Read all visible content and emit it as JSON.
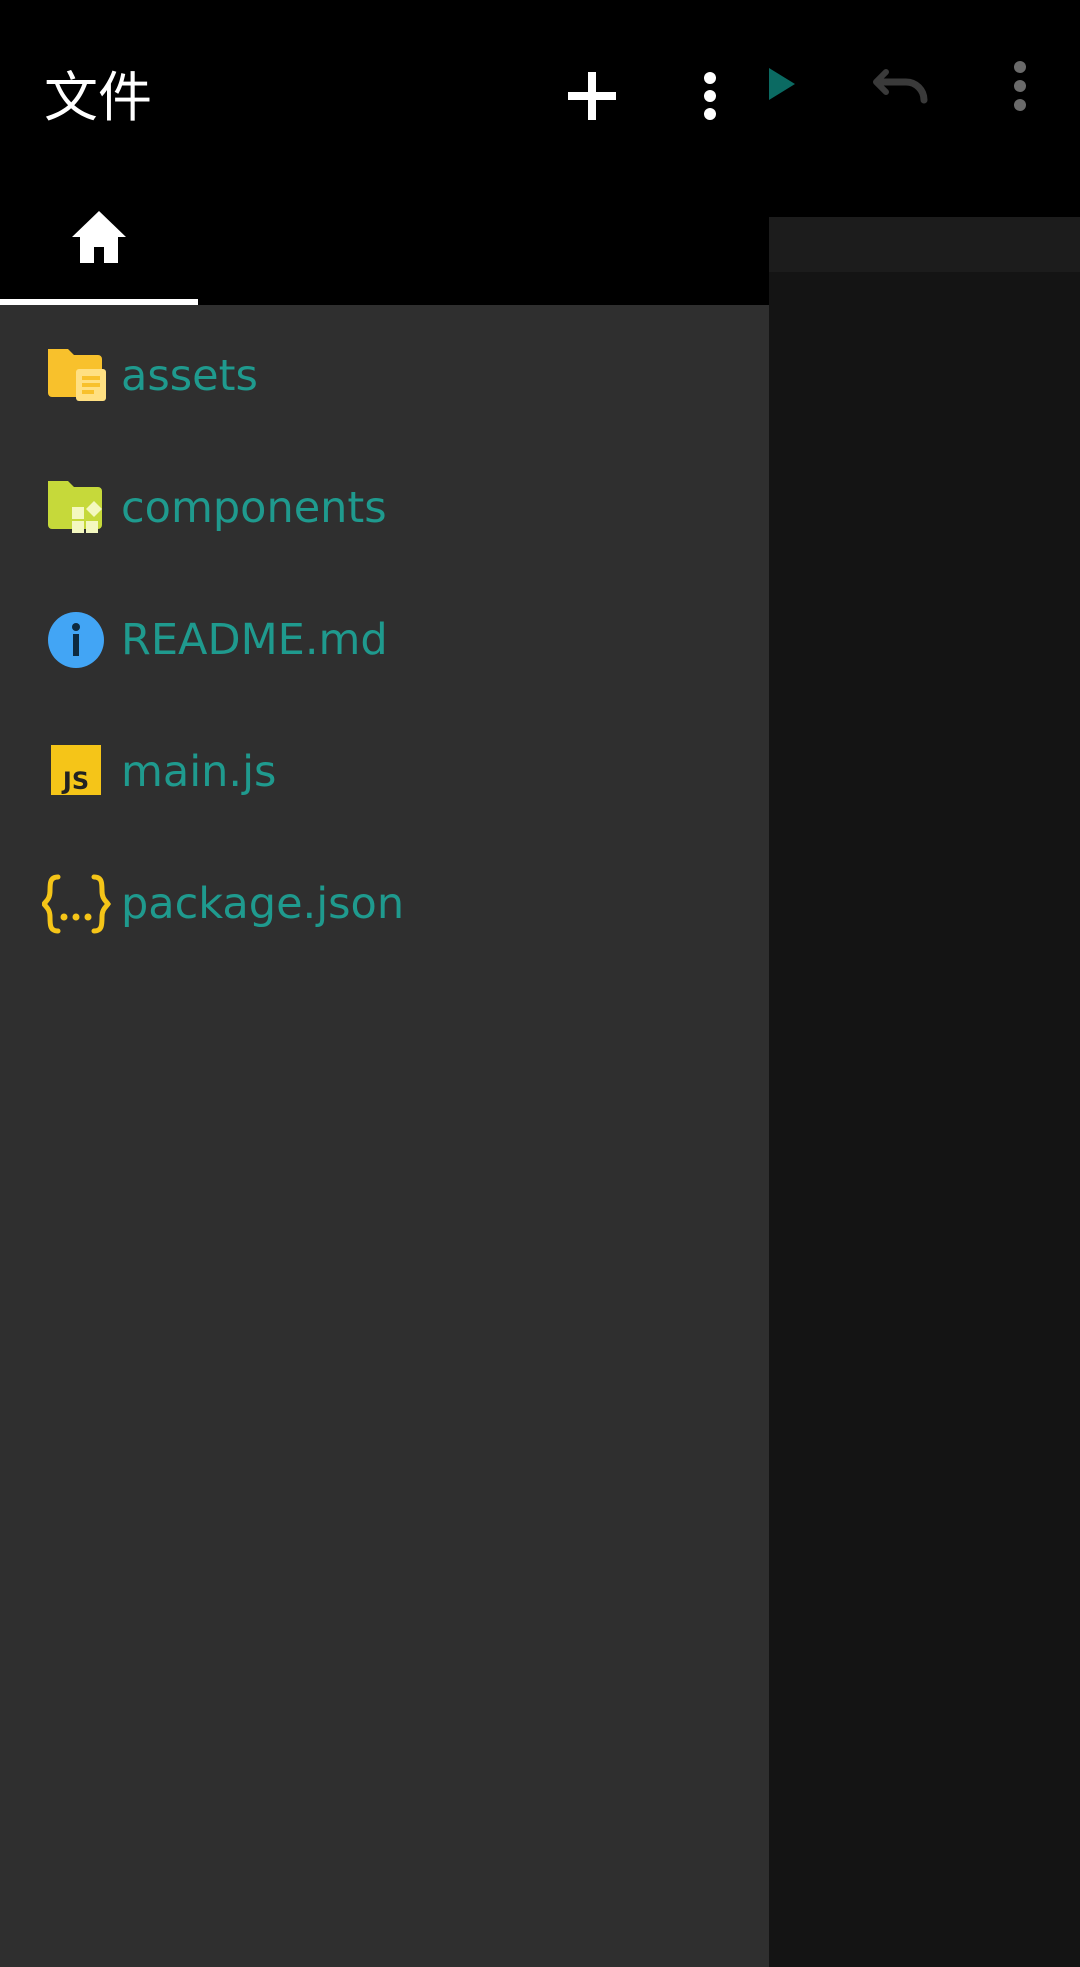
{
  "drawer": {
    "title": "文件",
    "actions": [
      "add-icon",
      "more-vertical-icon"
    ],
    "tab": {
      "icon": "home-icon",
      "selected": true
    }
  },
  "files": [
    {
      "name": "assets",
      "icon": "folder-assets-icon"
    },
    {
      "name": "components",
      "icon": "folder-components-icon"
    },
    {
      "name": "README.md",
      "icon": "info-icon"
    },
    {
      "name": "main.js",
      "icon": "javascript-icon"
    },
    {
      "name": "package.json",
      "icon": "json-braces-icon"
    }
  ],
  "background_toolbar": {
    "icons": [
      "run-icon",
      "undo-icon",
      "more-vertical-icon"
    ]
  },
  "colors": {
    "accent_teal": "#1f9a8e",
    "drawer_bg": "#2f2f2f",
    "header_bg": "#000000",
    "editor_bg": "#141414",
    "folder_yellow": "#f8c12c",
    "folder_lime": "#c6d93a",
    "info_blue": "#42a5f5",
    "js_yellow": "#f5c518"
  }
}
